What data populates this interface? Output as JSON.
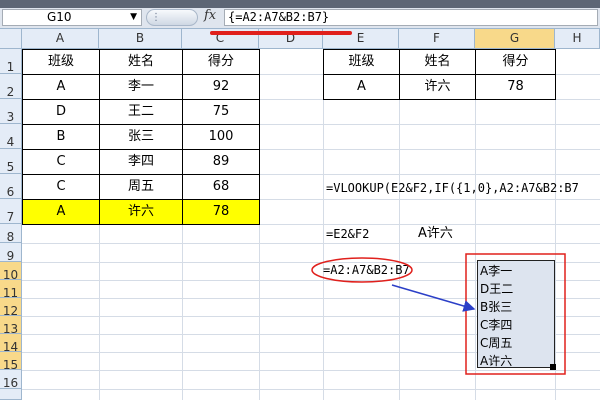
{
  "formula_bar": {
    "name_box": "G10",
    "fx_label": "fx",
    "formula": "{=A2:A7&B2:B7}"
  },
  "columns": [
    "A",
    "B",
    "C",
    "D",
    "E",
    "F",
    "G",
    "H"
  ],
  "rows": [
    "1",
    "2",
    "3",
    "4",
    "5",
    "6",
    "7",
    "8",
    "9",
    "10",
    "11",
    "12",
    "13",
    "14",
    "15",
    "16"
  ],
  "table1": {
    "headers": [
      "班级",
      "姓名",
      "得分"
    ],
    "rows": [
      [
        "A",
        "李一",
        "92"
      ],
      [
        "D",
        "王二",
        "75"
      ],
      [
        "B",
        "张三",
        "100"
      ],
      [
        "C",
        "李四",
        "89"
      ],
      [
        "C",
        "周五",
        "68"
      ],
      [
        "A",
        "许六",
        "78"
      ]
    ]
  },
  "table2": {
    "headers": [
      "班级",
      "姓名",
      "得分"
    ],
    "row": [
      "A",
      "许六",
      "78"
    ]
  },
  "notes": {
    "vlookup_formula": "=VLOOKUP(E2&F2,IF({1,0},A2:A7&B2:B7",
    "concat_formula": "=E2&F2",
    "concat_result": "A许六",
    "array_formula": "=A2:A7&B2:B7"
  },
  "array_result": [
    "A李一",
    "D王二",
    "B张三",
    "C李四",
    "C周五",
    "A许六"
  ],
  "colors": {
    "highlight_row": "#ffff00",
    "annotation_red": "#e0201c",
    "arrow_blue": "#2b3fc7",
    "selected_header": "#f8d98a"
  }
}
